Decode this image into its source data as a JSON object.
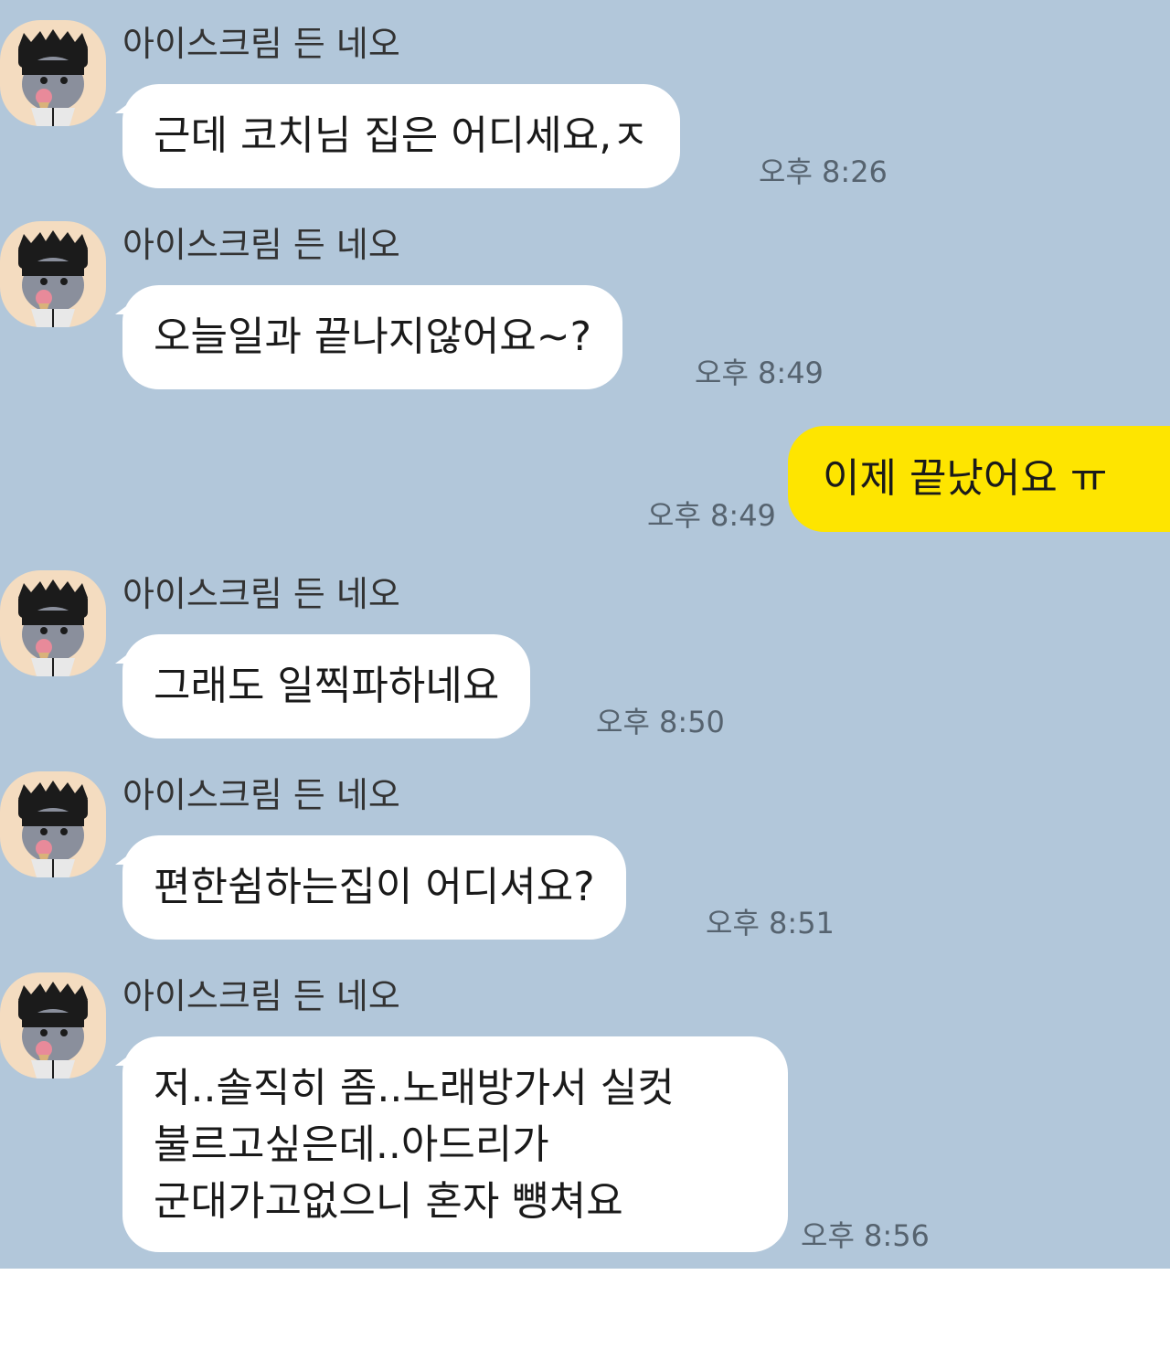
{
  "chat": {
    "background": "#b2c7da",
    "messages": [
      {
        "sender": "아이스크림 든 네오",
        "text": "근데 코치님 집은 어디세요,ㅈ",
        "time": "오후 8:26"
      },
      {
        "sender": "아이스크림 든 네오",
        "text": "오늘일과 끝나지않어요~?",
        "time": "오후 8:49"
      },
      {
        "sender": "",
        "text": "이제 끝났어요 ㅠ",
        "time": "오후 8:49",
        "outgoing": true
      },
      {
        "sender": "아이스크림 든 네오",
        "text": "그래도 일찍파하네요",
        "time": "오후 8:50"
      },
      {
        "sender": "아이스크림 든 네오",
        "text": "편한쉼하는집이 어디셔요?",
        "time": "오후 8:51"
      },
      {
        "sender": "아이스크림 든 네오",
        "lines": [
          "저..솔직히 좀..노래방가서 실컷",
          "불르고싶은데..아드리가",
          "군대가고없으니 혼자 뻉쳐요"
        ],
        "time": "오후 8:56"
      }
    ],
    "avatar_icon": "neo-character-avatar-icon",
    "outgoing_bubble_color": "#fee500",
    "incoming_bubble_color": "#ffffff"
  }
}
